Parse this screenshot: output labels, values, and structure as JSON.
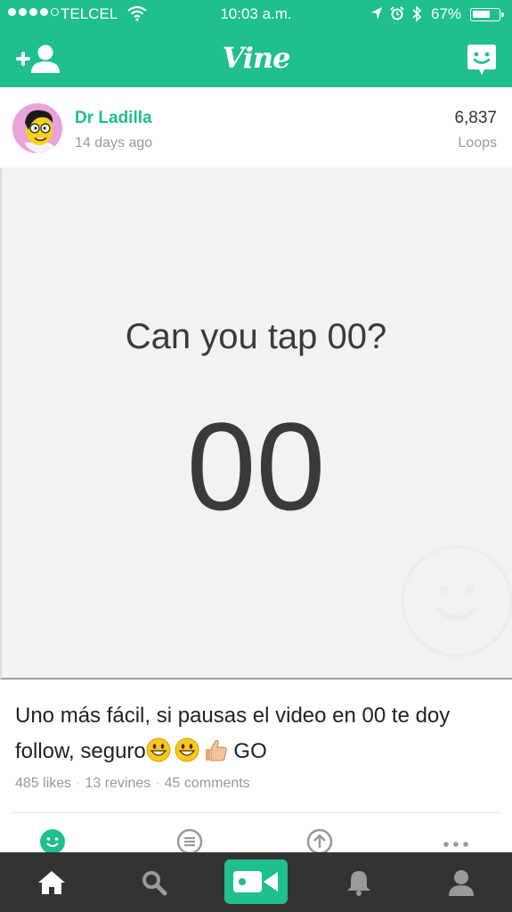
{
  "status_bar": {
    "carrier": "TELCEL",
    "time": "10:03 a.m.",
    "battery": "67%",
    "battery_level": 0.67
  },
  "header": {
    "logo": "Vine",
    "left_icon": "add-friend-icon",
    "right_icon": "messages-icon"
  },
  "post": {
    "username": "Dr Ladilla",
    "age": "14 days ago",
    "loops_count": "6,837",
    "loops_label": "Loops",
    "video": {
      "prompt": "Can you tap 00?",
      "counter": "00"
    },
    "caption_text": "Uno más fácil, si pausas el video en 00 te doy follow, seguro",
    "caption_emojis": [
      "grinning-face",
      "grinning-face",
      "thumbs-up"
    ],
    "caption_end": " GO",
    "stats": {
      "likes": "485 likes",
      "revines": "13 revines",
      "comments": "45 comments"
    }
  },
  "actions": [
    "like-icon",
    "comment-icon",
    "revine-icon",
    "more-icon"
  ],
  "tabbar": [
    "home-icon",
    "search-icon",
    "record-icon",
    "notifications-icon",
    "profile-icon"
  ],
  "colors": {
    "brand": "#1fbf8f",
    "tabbar": "#333333"
  }
}
